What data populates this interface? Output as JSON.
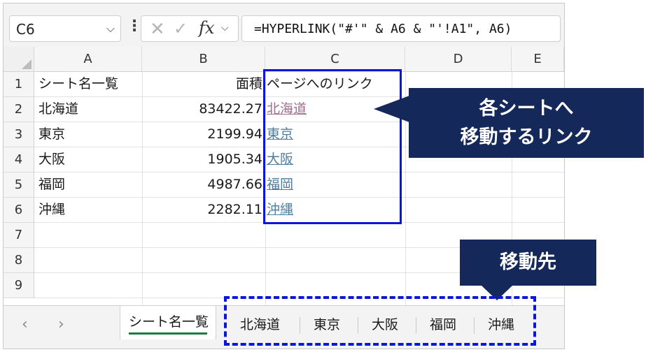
{
  "formula_bar": {
    "name_box": "C6",
    "formula": "=HYPERLINK(\"#'\" & A6 & \"'!A1\", A6)",
    "fx_label": "fx"
  },
  "grid": {
    "columns": [
      "A",
      "B",
      "C",
      "D",
      "E"
    ],
    "row_numbers": [
      "1",
      "2",
      "3",
      "4",
      "5",
      "6",
      "7",
      "8",
      "9"
    ],
    "rows": [
      {
        "a": "シート名一覧",
        "b": "面積",
        "c": "ページへのリンク"
      },
      {
        "a": "北海道",
        "b": "83422.27",
        "c": "北海道"
      },
      {
        "a": "東京",
        "b": "2199.94",
        "c": "東京"
      },
      {
        "a": "大阪",
        "b": "1905.34",
        "c": "大阪"
      },
      {
        "a": "福岡",
        "b": "4987.66",
        "c": "福岡"
      },
      {
        "a": "沖縄",
        "b": "2282.11",
        "c": "沖縄"
      }
    ]
  },
  "sheet_tabs": {
    "active": "シート名一覧",
    "others": [
      "北海道",
      "東京",
      "大阪",
      "福岡",
      "沖縄"
    ]
  },
  "annotations": {
    "callout_line1": "各シートへ",
    "callout_line2": "移動するリンク",
    "destination_label": "移動先"
  },
  "colors": {
    "hyperlink": "#4f7e9c",
    "visited_link": "#9c6f8f",
    "callout_bg": "#14285a",
    "highlight_border": "#0b17d6",
    "active_tab_underline": "#1e7a3e"
  }
}
